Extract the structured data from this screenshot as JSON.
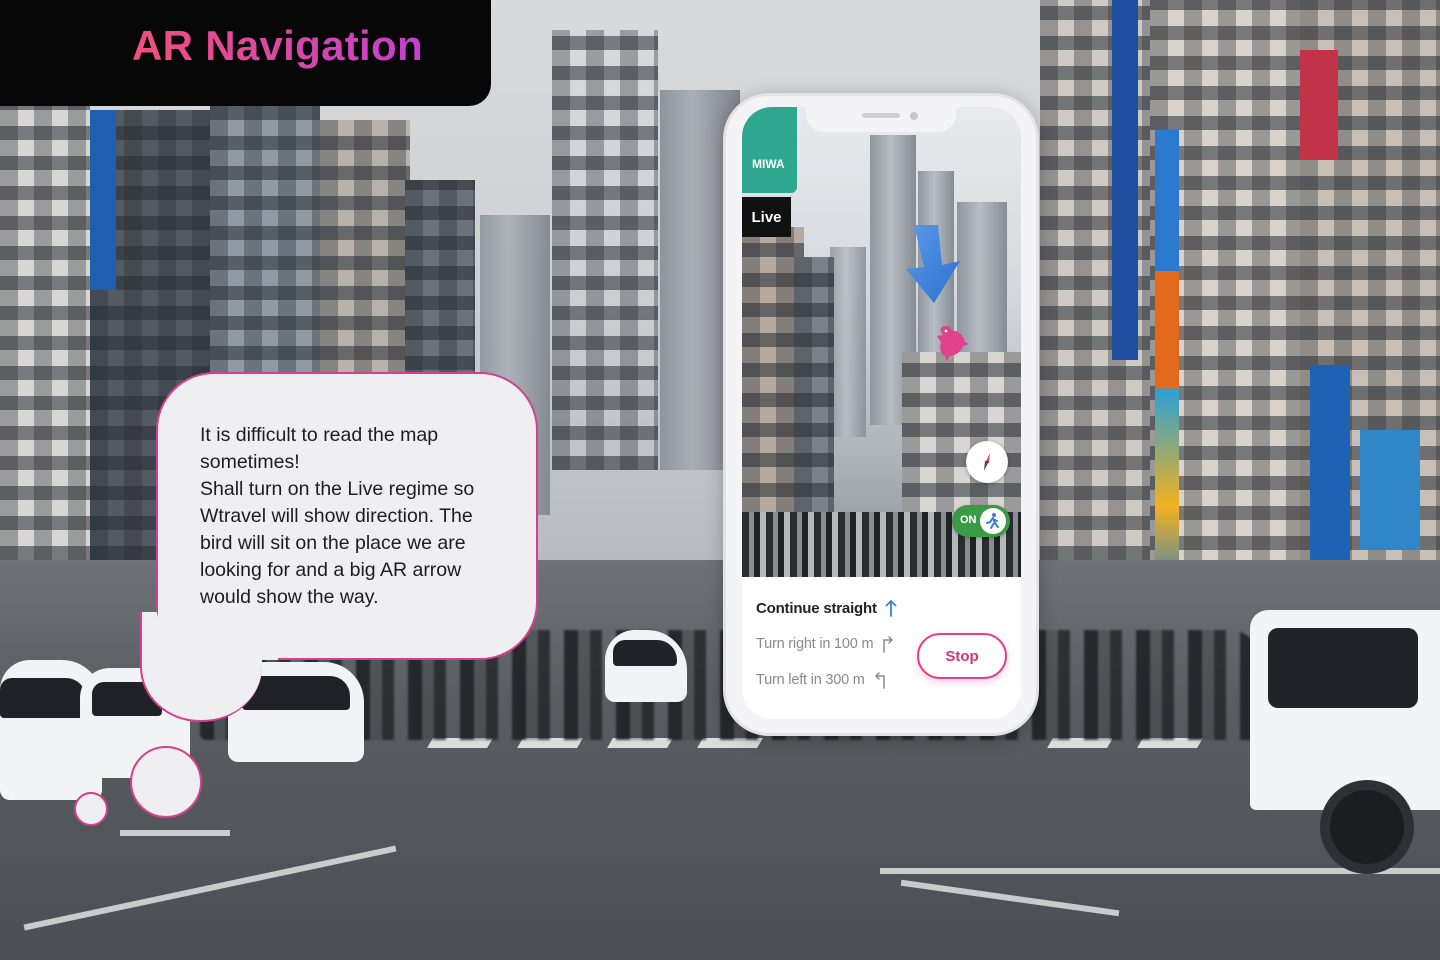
{
  "header": {
    "title": "AR Navigation",
    "gradient_from": "#f0507a",
    "gradient_to": "#c53fd0"
  },
  "bubble": {
    "lines": [
      "It is difficult to read the map",
      "sometimes!",
      "Shall turn on the Live regime so",
      "Wtravel will show direction. The",
      "bird will sit on the place we are",
      "looking for and a big AR arrow",
      "would show the way."
    ],
    "border_color": "#d63f8d"
  },
  "phone": {
    "shop_sign": "MIWA",
    "live_label": "Live",
    "toggle_label": "ON",
    "directions": {
      "main": "Continue straight",
      "next": "Turn right in 100 m",
      "after": "Turn left in 300 m"
    },
    "stop_label": "Stop",
    "accent": "#e0418c",
    "arrow_color": "#3a7fd6",
    "bird_color": "#e0418c"
  }
}
